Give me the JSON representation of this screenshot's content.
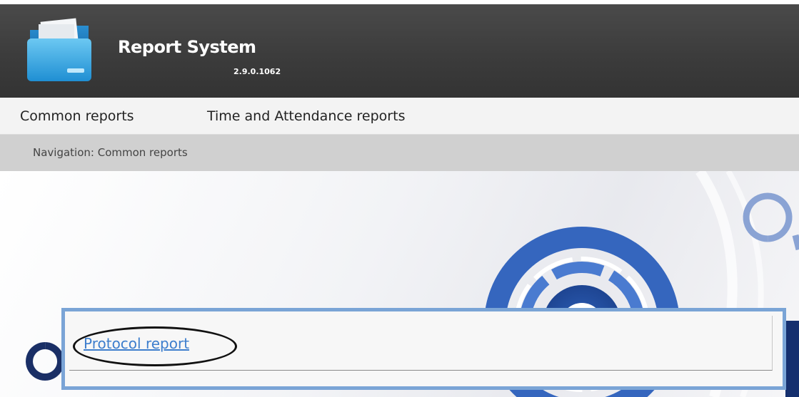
{
  "app": {
    "title": "Report System",
    "version": "2.9.0.1062",
    "icon": "folder-icon"
  },
  "menu": {
    "items": [
      {
        "label": "Common reports"
      },
      {
        "label": "Time and Attendance reports"
      }
    ]
  },
  "navigation": {
    "text": "Navigation: Common reports"
  },
  "reports": {
    "items": [
      {
        "label": "Protocol report"
      }
    ]
  },
  "colors": {
    "header": "#3c3c3c",
    "menubar": "#f3f3f3",
    "navbar": "#d0d0d0",
    "link": "#3d7ecd",
    "popup_border": "#7aa4d6"
  }
}
